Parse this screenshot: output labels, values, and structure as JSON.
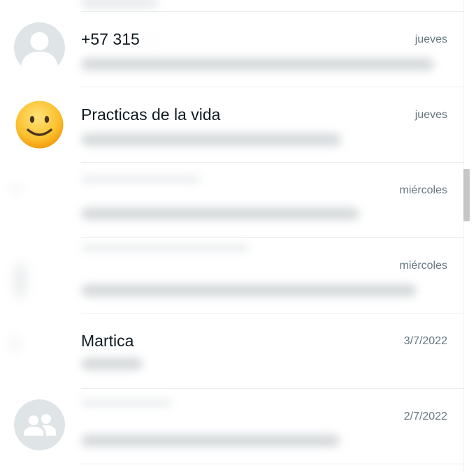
{
  "chats": [
    {
      "name": "+57 315",
      "time": "jueves",
      "avatar_icon": "default-person-icon"
    },
    {
      "name": "Practicas de la vida",
      "time": "jueves",
      "avatar_icon": "slightly-smiling-face-emoji-icon"
    },
    {
      "name": "",
      "time": "miércoles",
      "avatar_icon": ""
    },
    {
      "name": "",
      "time": "miércoles",
      "avatar_icon": ""
    },
    {
      "name": "Martica",
      "time": "3/7/2022",
      "avatar_icon": ""
    },
    {
      "name": "",
      "time": "2/7/2022",
      "avatar_icon": "default-group-icon"
    }
  ],
  "colors": {
    "background": "#ffffff",
    "divider": "#e9edef",
    "name_text": "#111b21",
    "time_text": "#667781",
    "avatar_grey": "#dfe5e7",
    "scrollbar_thumb": "#c6c6c6"
  }
}
